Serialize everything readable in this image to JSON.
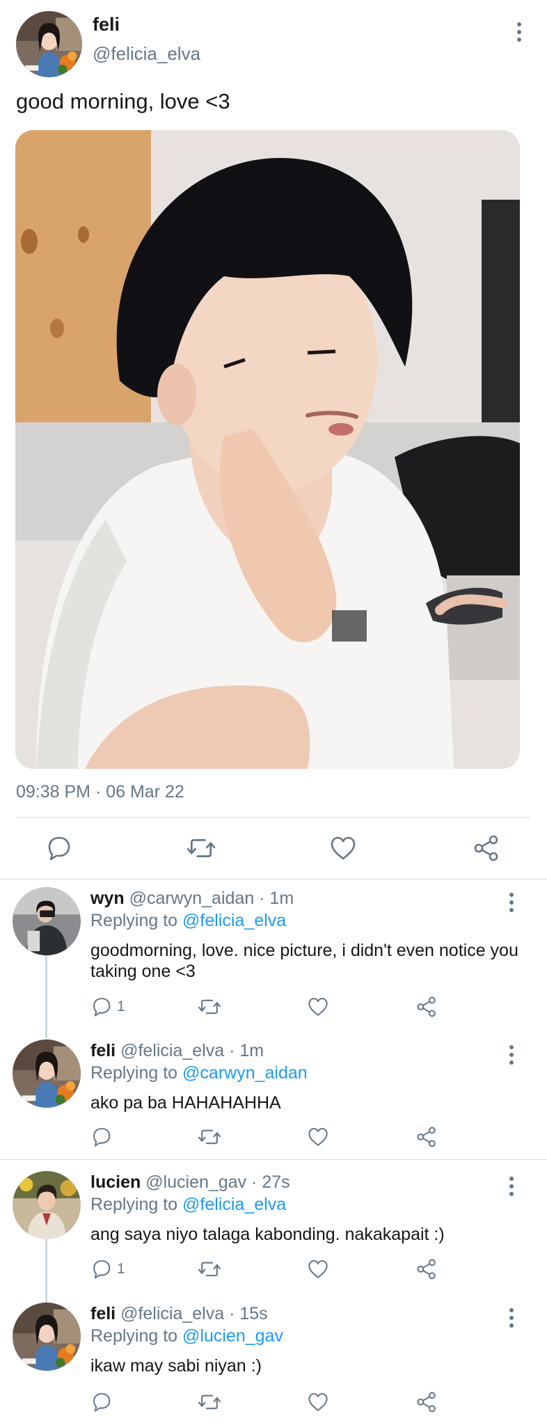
{
  "main_tweet": {
    "name": "feli",
    "handle": "@felicia_elva",
    "text": "good morning, love <3",
    "timestamp": "09:38 PM · 06 Mar 22",
    "icons": {
      "more": "kebab-icon",
      "reply": "comment-icon",
      "retweet": "retweet-icon",
      "like": "heart-icon",
      "share": "share-icon"
    }
  },
  "replies": [
    {
      "name": "wyn",
      "meta": "@carwyn_aidan · 1m",
      "replying_label": "Replying to",
      "replying_to": "@felicia_elva",
      "text": "goodmorning, love. nice picture, i didn't even notice you taking one <3",
      "reply_count": "1"
    },
    {
      "name": "feli",
      "meta": "@felicia_elva · 1m",
      "replying_label": "Replying to",
      "replying_to": "@carwyn_aidan",
      "text": "ako pa ba HAHAHAHHA",
      "reply_count": ""
    },
    {
      "name": "lucien",
      "meta": "@lucien_gav · 27s",
      "replying_label": "Replying to",
      "replying_to": "@felicia_elva",
      "text": "ang saya niyo talaga kabonding. nakakapait :)",
      "reply_count": "1"
    },
    {
      "name": "feli",
      "meta": "@felicia_elva · 15s",
      "replying_label": "Replying to",
      "replying_to": "@lucien_gav",
      "text": "ikaw may sabi niyan :)",
      "reply_count": ""
    }
  ],
  "colors": {
    "link": "#1d9bf0",
    "secondary_text": "#657786",
    "divider": "#d9dee2"
  }
}
